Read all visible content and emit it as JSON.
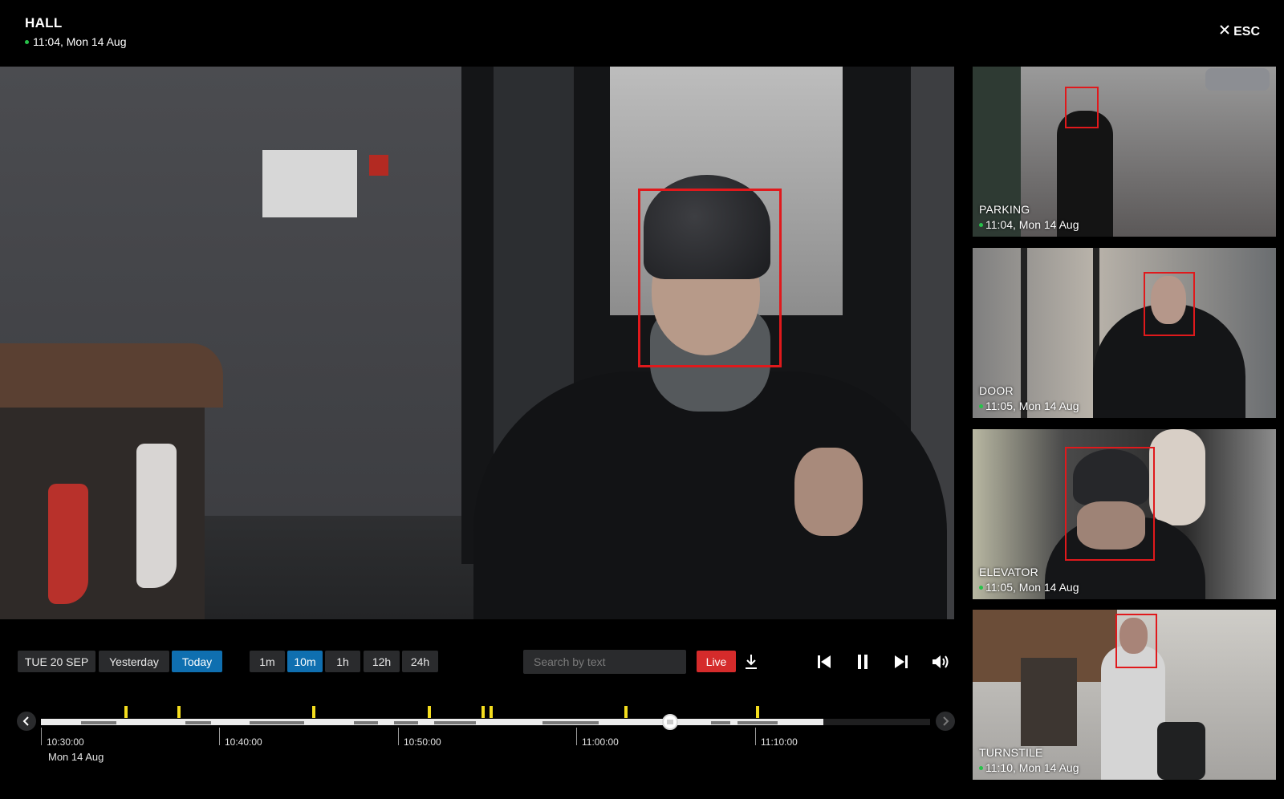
{
  "header": {
    "title": "HALL",
    "timestamp": "11:04, Mon 14 Aug",
    "close_label": "ESC"
  },
  "cameras": [
    {
      "name": "PARKING",
      "time": "11:04, Mon 14 Aug"
    },
    {
      "name": "DOOR",
      "time": "11:05, Mon 14 Aug"
    },
    {
      "name": "ELEVATOR",
      "time": "11:05, Mon 14 Aug"
    },
    {
      "name": "TURNSTILE",
      "time": "11:10, Mon 14 Aug"
    }
  ],
  "date_buttons": [
    "TUE 20 SEP",
    "Yesterday",
    "Today"
  ],
  "date_selected": "Today",
  "range_buttons": [
    "1m",
    "10m",
    "1h",
    "12h",
    "24h"
  ],
  "range_selected": "10m",
  "search": {
    "placeholder": "Search by text",
    "value": ""
  },
  "live_label": "Live",
  "icons": {
    "close": "close-icon",
    "download": "download-icon",
    "prev": "skip-back-icon",
    "pause": "pause-icon",
    "next": "skip-forward-icon",
    "volume": "volume-icon",
    "timeline_prev": "chevron-left-icon",
    "timeline_next": "chevron-right-icon"
  },
  "colors": {
    "accent": "#0f6fb0",
    "live": "#d52b2b",
    "detection": "#e0191c",
    "status_dot": "#27c24a",
    "event_marker": "#f4dd1e"
  },
  "timeline": {
    "labels": [
      "10:30:00",
      "10:40:00",
      "10:50:00",
      "11:00:00",
      "11:10:00"
    ],
    "start_date": "Mon 14 Aug"
  }
}
